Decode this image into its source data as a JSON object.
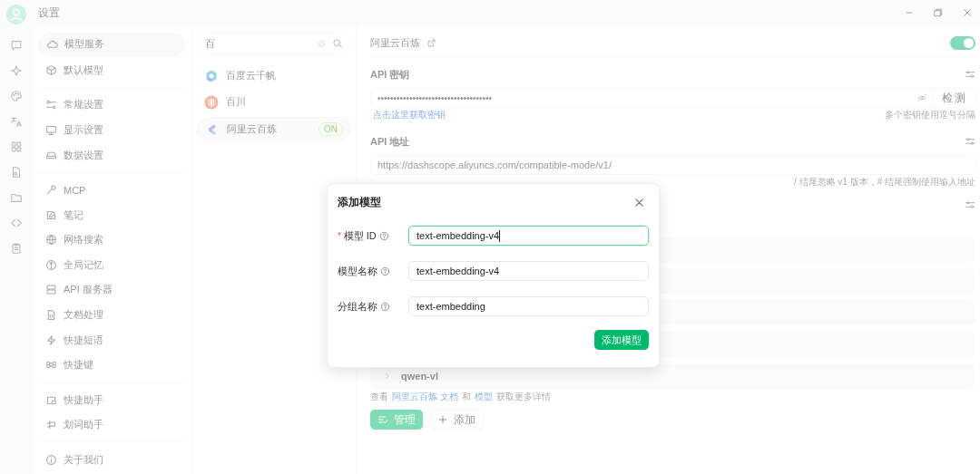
{
  "window": {
    "title": "设置"
  },
  "settings_menu": {
    "groups": [
      [
        {
          "label": "模型服务",
          "selected": true
        },
        {
          "label": "默认模型",
          "selected": false
        }
      ],
      [
        {
          "label": "常规设置",
          "selected": false
        },
        {
          "label": "显示设置",
          "selected": false
        },
        {
          "label": "数据设置",
          "selected": false
        }
      ],
      [
        {
          "label": "MCP",
          "selected": false
        },
        {
          "label": "笔记",
          "selected": false
        },
        {
          "label": "网络搜索",
          "selected": false
        },
        {
          "label": "全局记忆",
          "selected": false
        },
        {
          "label": "API 服务器",
          "selected": false
        },
        {
          "label": "文档处理",
          "selected": false
        },
        {
          "label": "快捷短语",
          "selected": false
        },
        {
          "label": "快捷键",
          "selected": false
        }
      ],
      [
        {
          "label": "快捷助手",
          "selected": false
        },
        {
          "label": "划词助手",
          "selected": false
        }
      ],
      [
        {
          "label": "关于我们",
          "selected": false
        }
      ]
    ]
  },
  "provider_search": {
    "value": "百"
  },
  "providers": [
    {
      "name": "百度云千帆",
      "selected": false
    },
    {
      "name": "百川",
      "selected": false
    },
    {
      "name": "阿里云百炼",
      "selected": true,
      "badge": "ON"
    }
  ],
  "provider": {
    "name": "阿里云百炼",
    "enabled": true,
    "api_key": {
      "label": "API 密钥",
      "value": "••••••••••••••••••••••••••••••••••••",
      "check_button": "检测",
      "help_link": "点击这里获取密钥",
      "hint": "多个密钥使用逗号分隔"
    },
    "api_url": {
      "label": "API 地址",
      "value": "https://dashscope.aliyuncs.com/compatible-mode/v1/",
      "hint": "/ 结尾忽略 v1 版本，# 结尾强制使用输入地址"
    },
    "model_groups": [
      {
        "name": "qwen-vl"
      }
    ],
    "docs_note": [
      {
        "text": "查看",
        "link": false
      },
      {
        "text": "阿里云百炼 文档",
        "link": true
      },
      {
        "text": "和",
        "link": false
      },
      {
        "text": "模型",
        "link": true
      },
      {
        "text": "获取更多详情",
        "link": false
      }
    ],
    "buttons": [
      {
        "label": "管理",
        "kind": "primary"
      },
      {
        "label": "添加",
        "kind": "secondary"
      }
    ]
  },
  "dialog": {
    "title": "添加模型",
    "required_mark": "*",
    "fields": [
      {
        "label": "模型 ID",
        "required": true,
        "value": "text-embedding-v4",
        "focused": true
      },
      {
        "label": "模型名称",
        "required": false,
        "value": "text-embedding-v4",
        "focused": false
      },
      {
        "label": "分组名称",
        "required": false,
        "value": "text-embedding",
        "focused": false
      }
    ],
    "submit": "添加模型"
  }
}
